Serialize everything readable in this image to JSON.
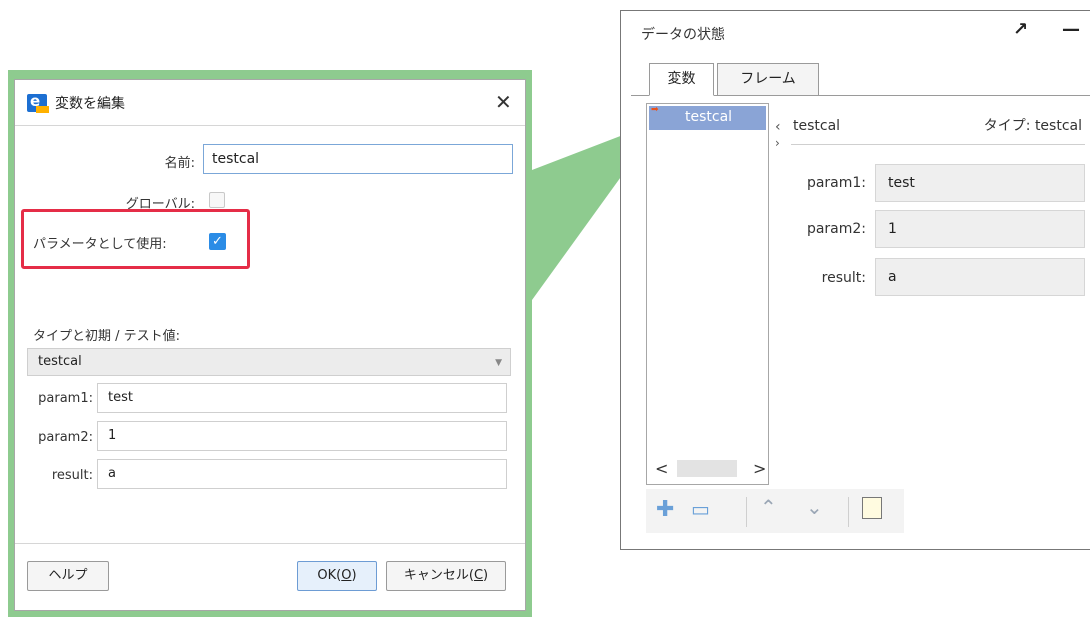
{
  "dialog": {
    "title": "変数を編集",
    "name_label": "名前:",
    "name_value": "testcal",
    "global_label": "グローバル:",
    "global_checked": false,
    "use_as_param_label": "パラメータとして使用:",
    "use_as_param_checked": true,
    "type_section_label": "タイプと初期 / テスト値:",
    "type_value": "testcal",
    "params": [
      {
        "label": "param1:",
        "value": "test"
      },
      {
        "label": "param2:",
        "value": "1"
      },
      {
        "label": "result:",
        "value": "a"
      }
    ],
    "help_button": "ヘルプ",
    "ok_button_prefix": "OK(",
    "ok_button_key": "O",
    "ok_button_suffix": ")",
    "cancel_button_prefix": "キャンセル(",
    "cancel_button_key": "C",
    "cancel_button_suffix": ")"
  },
  "panel": {
    "title": "データの状態",
    "tabs": [
      {
        "label": "変数",
        "active": true
      },
      {
        "label": "フレーム",
        "active": false
      }
    ],
    "variables": [
      {
        "name": "testcal",
        "selected": true
      }
    ],
    "detail_name": "testcal",
    "detail_type": "タイプ: testcal",
    "detail_params": [
      {
        "label": "param1:",
        "value": "test"
      },
      {
        "label": "param2:",
        "value": "1"
      },
      {
        "label": "result:",
        "value": "a"
      }
    ]
  },
  "icons": {
    "close": "close-icon",
    "expand": "expand-icon",
    "minimize": "minimize-icon",
    "add": "plus-icon",
    "remove": "minus-icon",
    "up": "chevron-up-icon",
    "down": "chevron-down-icon",
    "edit": "edit-icon"
  },
  "colors": {
    "highlight_frame": "#8ecb8f",
    "callout_red": "#e52d47",
    "checkbox_blue": "#2b8ce6",
    "selection": "#8aa4d6"
  }
}
